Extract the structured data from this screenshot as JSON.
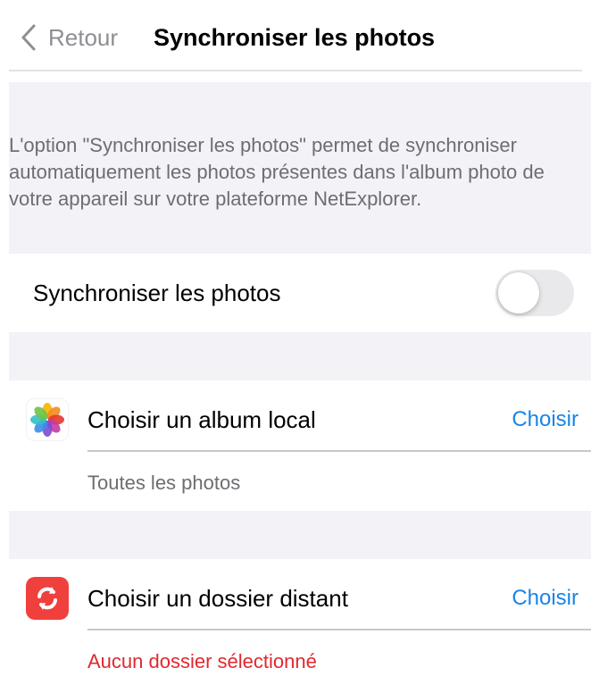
{
  "nav": {
    "back_label": "Retour",
    "title": "Synchroniser les photos"
  },
  "info": {
    "text": "L'option \"Synchroniser les photos\" permet de synchroniser automatiquement les photos présentes dans l'album photo de votre appareil sur votre plateforme NetExplorer."
  },
  "sync_toggle": {
    "label": "Synchroniser les photos",
    "enabled": false
  },
  "local_album": {
    "icon": "photos-app-icon",
    "label": "Choisir un album local",
    "action_label": "Choisir",
    "selection": "Toutes les photos"
  },
  "remote_folder": {
    "icon": "sync-folder-icon",
    "label": "Choisir un dossier distant",
    "action_label": "Choisir",
    "selection": "Aucun dossier sélectionné"
  },
  "colors": {
    "accent": "#1a84e6",
    "error": "#e0282e",
    "grouped_background": "#f2f2f7",
    "secondary_text": "#6d6d72",
    "remote_icon_bg": "#f0403e"
  }
}
